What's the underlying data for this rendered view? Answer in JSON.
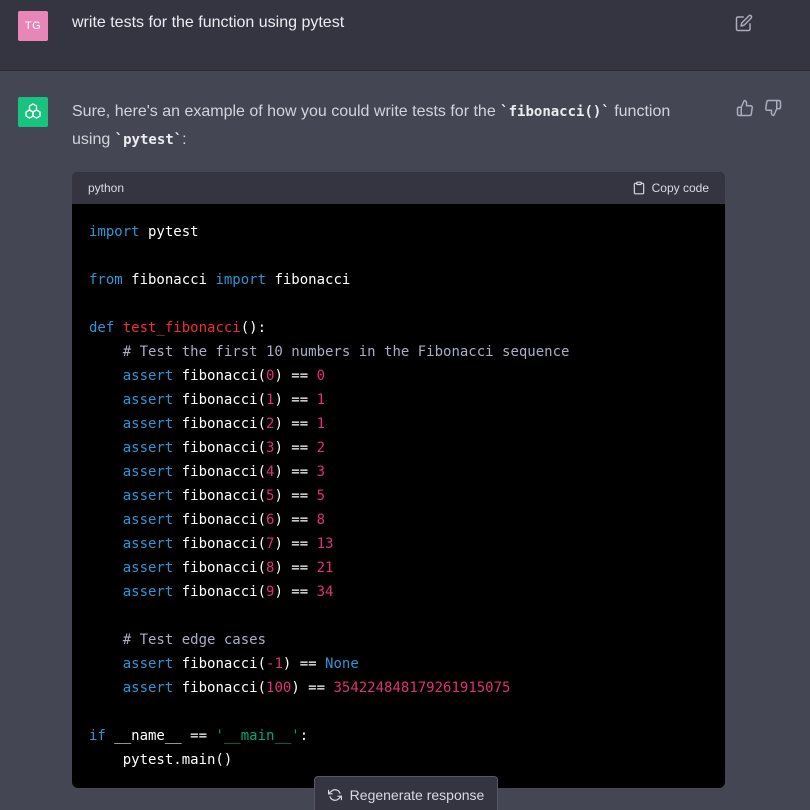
{
  "user": {
    "avatar_initials": "TG",
    "message": "write tests for the function using pytest"
  },
  "assistant": {
    "intro_prefix": "Sure, here's an example of how you could write tests for the ",
    "intro_code1": "`fibonacci()`",
    "intro_mid": " function using ",
    "intro_code2": "`pytest`",
    "intro_suffix": ":"
  },
  "codeblock": {
    "language": "python",
    "copy_label": "Copy code",
    "lines": [
      "import pytest",
      "",
      "from fibonacci import fibonacci",
      "",
      "def test_fibonacci():",
      "    # Test the first 10 numbers in the Fibonacci sequence",
      "    assert fibonacci(0) == 0",
      "    assert fibonacci(1) == 1",
      "    assert fibonacci(2) == 1",
      "    assert fibonacci(3) == 2",
      "    assert fibonacci(4) == 3",
      "    assert fibonacci(5) == 5",
      "    assert fibonacci(6) == 8",
      "    assert fibonacci(7) == 13",
      "    assert fibonacci(8) == 21",
      "    assert fibonacci(9) == 34",
      "",
      "    # Test edge cases",
      "    assert fibonacci(-1) == None",
      "    assert fibonacci(100) == 354224848179261915075",
      "",
      "if __name__ == '__main__':",
      "    pytest.main()"
    ]
  },
  "regenerate_label": "Regenerate response",
  "icons": {
    "edit": "edit-icon",
    "thumbs_up": "thumbs-up-icon",
    "thumbs_down": "thumbs-down-icon",
    "clipboard": "clipboard-icon",
    "regenerate": "refresh-icon",
    "assistant_logo": "openai-logo-icon"
  },
  "colors": {
    "user_avatar": "#e887b7",
    "assistant_avatar": "#19c37d",
    "keyword": "#2e95d3",
    "function_name": "#f22c3d",
    "number": "#df3079",
    "string": "#00a67d",
    "comment": "#a9aec1"
  }
}
